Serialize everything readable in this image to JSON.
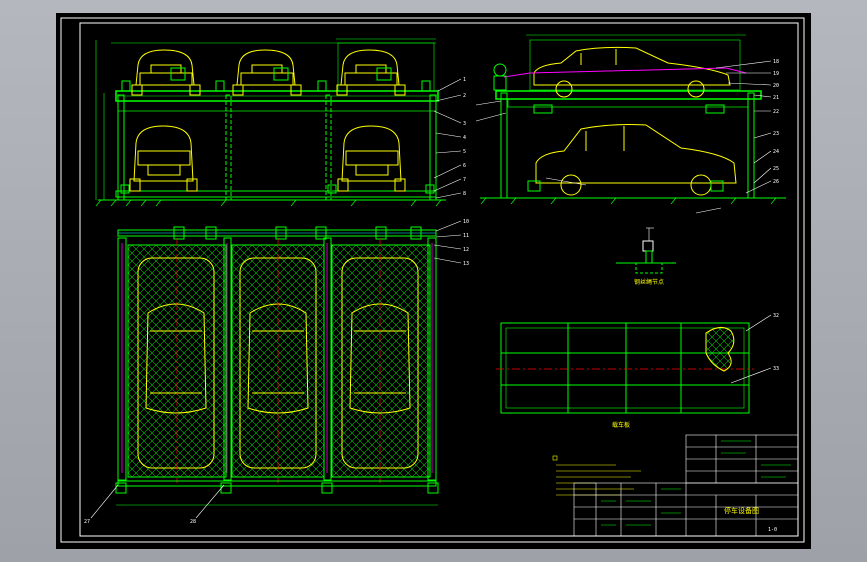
{
  "drawing": {
    "colors": {
      "frame": "#ffffff",
      "structure": "#00ff00",
      "car": "#ffff00",
      "leader": "#ffffff",
      "centerline": "#ff0000",
      "accent": "#ff00ff",
      "hidden": "#00ffff",
      "background": "#000000"
    },
    "front_callouts": [
      "1",
      "2",
      "3",
      "4",
      "5",
      "6",
      "7",
      "8"
    ],
    "side_callouts": [
      "18",
      "19",
      "20",
      "21",
      "22",
      "23",
      "24",
      "25",
      "26"
    ],
    "plan_callouts": [
      "10",
      "11",
      "12",
      "13"
    ],
    "bottom_callouts": [
      "27",
      "28"
    ],
    "pallet_callouts": [
      "32",
      "33"
    ],
    "detail_label": "钢丝绳节点",
    "pallet_label": "载车板",
    "title_block_label": "停车设备图",
    "drawing_no": "1-0"
  }
}
